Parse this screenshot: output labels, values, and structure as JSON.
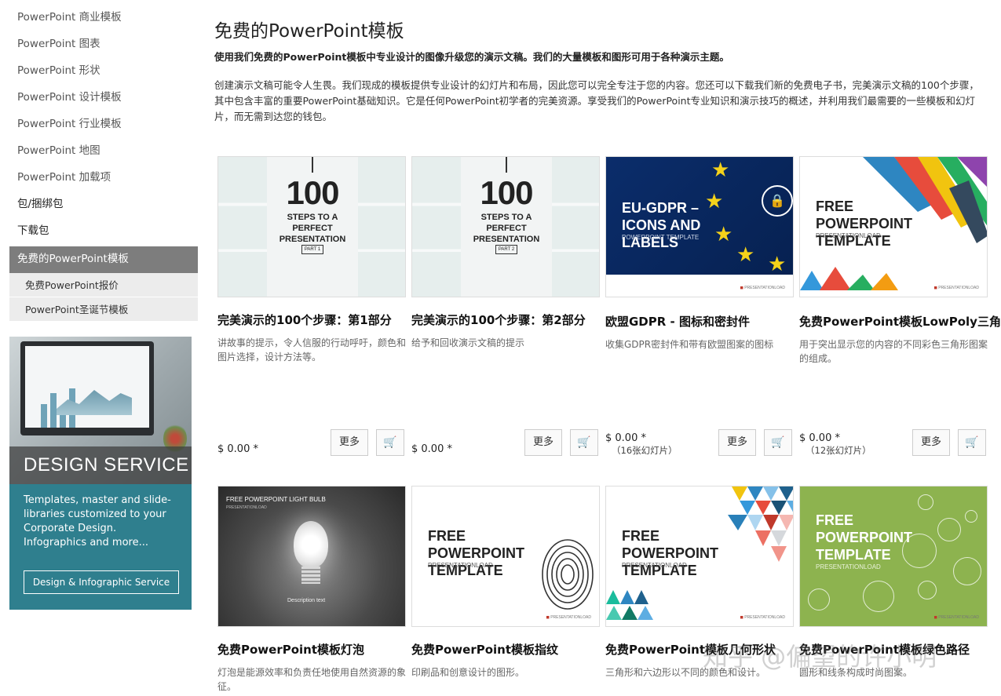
{
  "sidebar": {
    "items": [
      {
        "label": "PowerPoint 商业模板"
      },
      {
        "label": "PowerPoint 图表"
      },
      {
        "label": "PowerPoint 形状"
      },
      {
        "label": "PowerPoint 设计模板"
      },
      {
        "label": "PowerPoint 行业模板"
      },
      {
        "label": "PowerPoint 地图"
      },
      {
        "label": "PowerPoint 加载项"
      },
      {
        "label": "包/捆绑包"
      },
      {
        "label": "下载包"
      }
    ],
    "active": "免费的PowerPoint模板",
    "subitems": [
      {
        "label": "免费PowerPoint报价"
      },
      {
        "label": "PowerPoint圣诞节模板"
      }
    ]
  },
  "promo": {
    "title": "DESIGN SERVICE",
    "text": "Templates, master and slide-libraries customized to your Corporate Design. Infographics and more...",
    "button": "Design & Infographic Service"
  },
  "main": {
    "title": "免费的PowerPoint模板",
    "lead": "使用我们免费的PowerPoint模板中专业设计的图像升级您的演示文稿。我们的大量模板和图形可用于各种演示主题。",
    "body": "创建演示文稿可能令人生畏。我们现成的模板提供专业设计的幻灯片和布局，因此您可以完全专注于您的内容。您还可以下载我们新的免费电子书，完美演示文稿的100个步骤，其中包含丰富的重要PowerPoint基础知识。它是任何PowerPoint初学者的完美资源。享受我们的PowerPoint专业知识和演示技巧的概述，并利用我们最需要的一些模板和幻灯片，而无需到达您的钱包。"
  },
  "buttons": {
    "more": "更多",
    "cart_icon": "cart-icon"
  },
  "thumbs": {
    "steps_big": "100",
    "steps_sub": "STEPS TO A PERFECT PRESENTATION",
    "part1": "PART 1",
    "part2": "PART 2",
    "gdpr_title": "EU-GDPR – ICONS AND LABELS",
    "gdpr_sub": "POWERPOINT TEMPLATE",
    "free_title": "FREE POWERPOINT TEMPLATE",
    "free_sub": "PRESENTATIONLOAD",
    "bulb_title": "FREE POWERPOINT LIGHT BULB",
    "bulb_sub": "PRESENTATIONLOAD",
    "bulb_desc": "Description text",
    "brand": "PRESENTATIONLOAD"
  },
  "cards": [
    {
      "title": "完美演示的100个步骤：第1部分",
      "desc": "讲故事的提示，令人信服的行动呼吁，颜色和图片选择，设计方法等。",
      "price": "$ 0.00 *",
      "slides": ""
    },
    {
      "title": "完美演示的100个步骤：第2部分",
      "desc": "给予和回收演示文稿的提示",
      "price": "$ 0.00 *",
      "slides": ""
    },
    {
      "title": "欧盟GDPR - 图标和密封件",
      "desc": "收集GDPR密封件和带有欧盟图案的图标",
      "price": "$ 0.00 *",
      "slides": "（16张幻灯片）"
    },
    {
      "title": "免费PowerPoint模板LowPoly三角形",
      "desc": "用于突出显示您的内容的不同彩色三角形图案的组成。",
      "price": "$ 0.00 *",
      "slides": "（12张幻灯片）"
    },
    {
      "title": "免费PowerPoint模板灯泡",
      "desc": "灯泡是能源效率和负责任地使用自然资源的象征。"
    },
    {
      "title": "免费PowerPoint模板指纹",
      "desc": "印刷品和创意设计的图形。"
    },
    {
      "title": "免费PowerPoint模板几何形状",
      "desc": "三角形和六边形以不同的颜色和设计。"
    },
    {
      "title": "免费PowerPoint模板绿色路径",
      "desc": "圆形和线条构成时尚图案。"
    }
  ],
  "watermark": "知乎 @偏望的许小明",
  "colors": {
    "accent": "#2f7f8e",
    "active_nav": "#7d7d7d",
    "gdpr_blue": "#0b2d6b",
    "green": "#8db34f"
  }
}
